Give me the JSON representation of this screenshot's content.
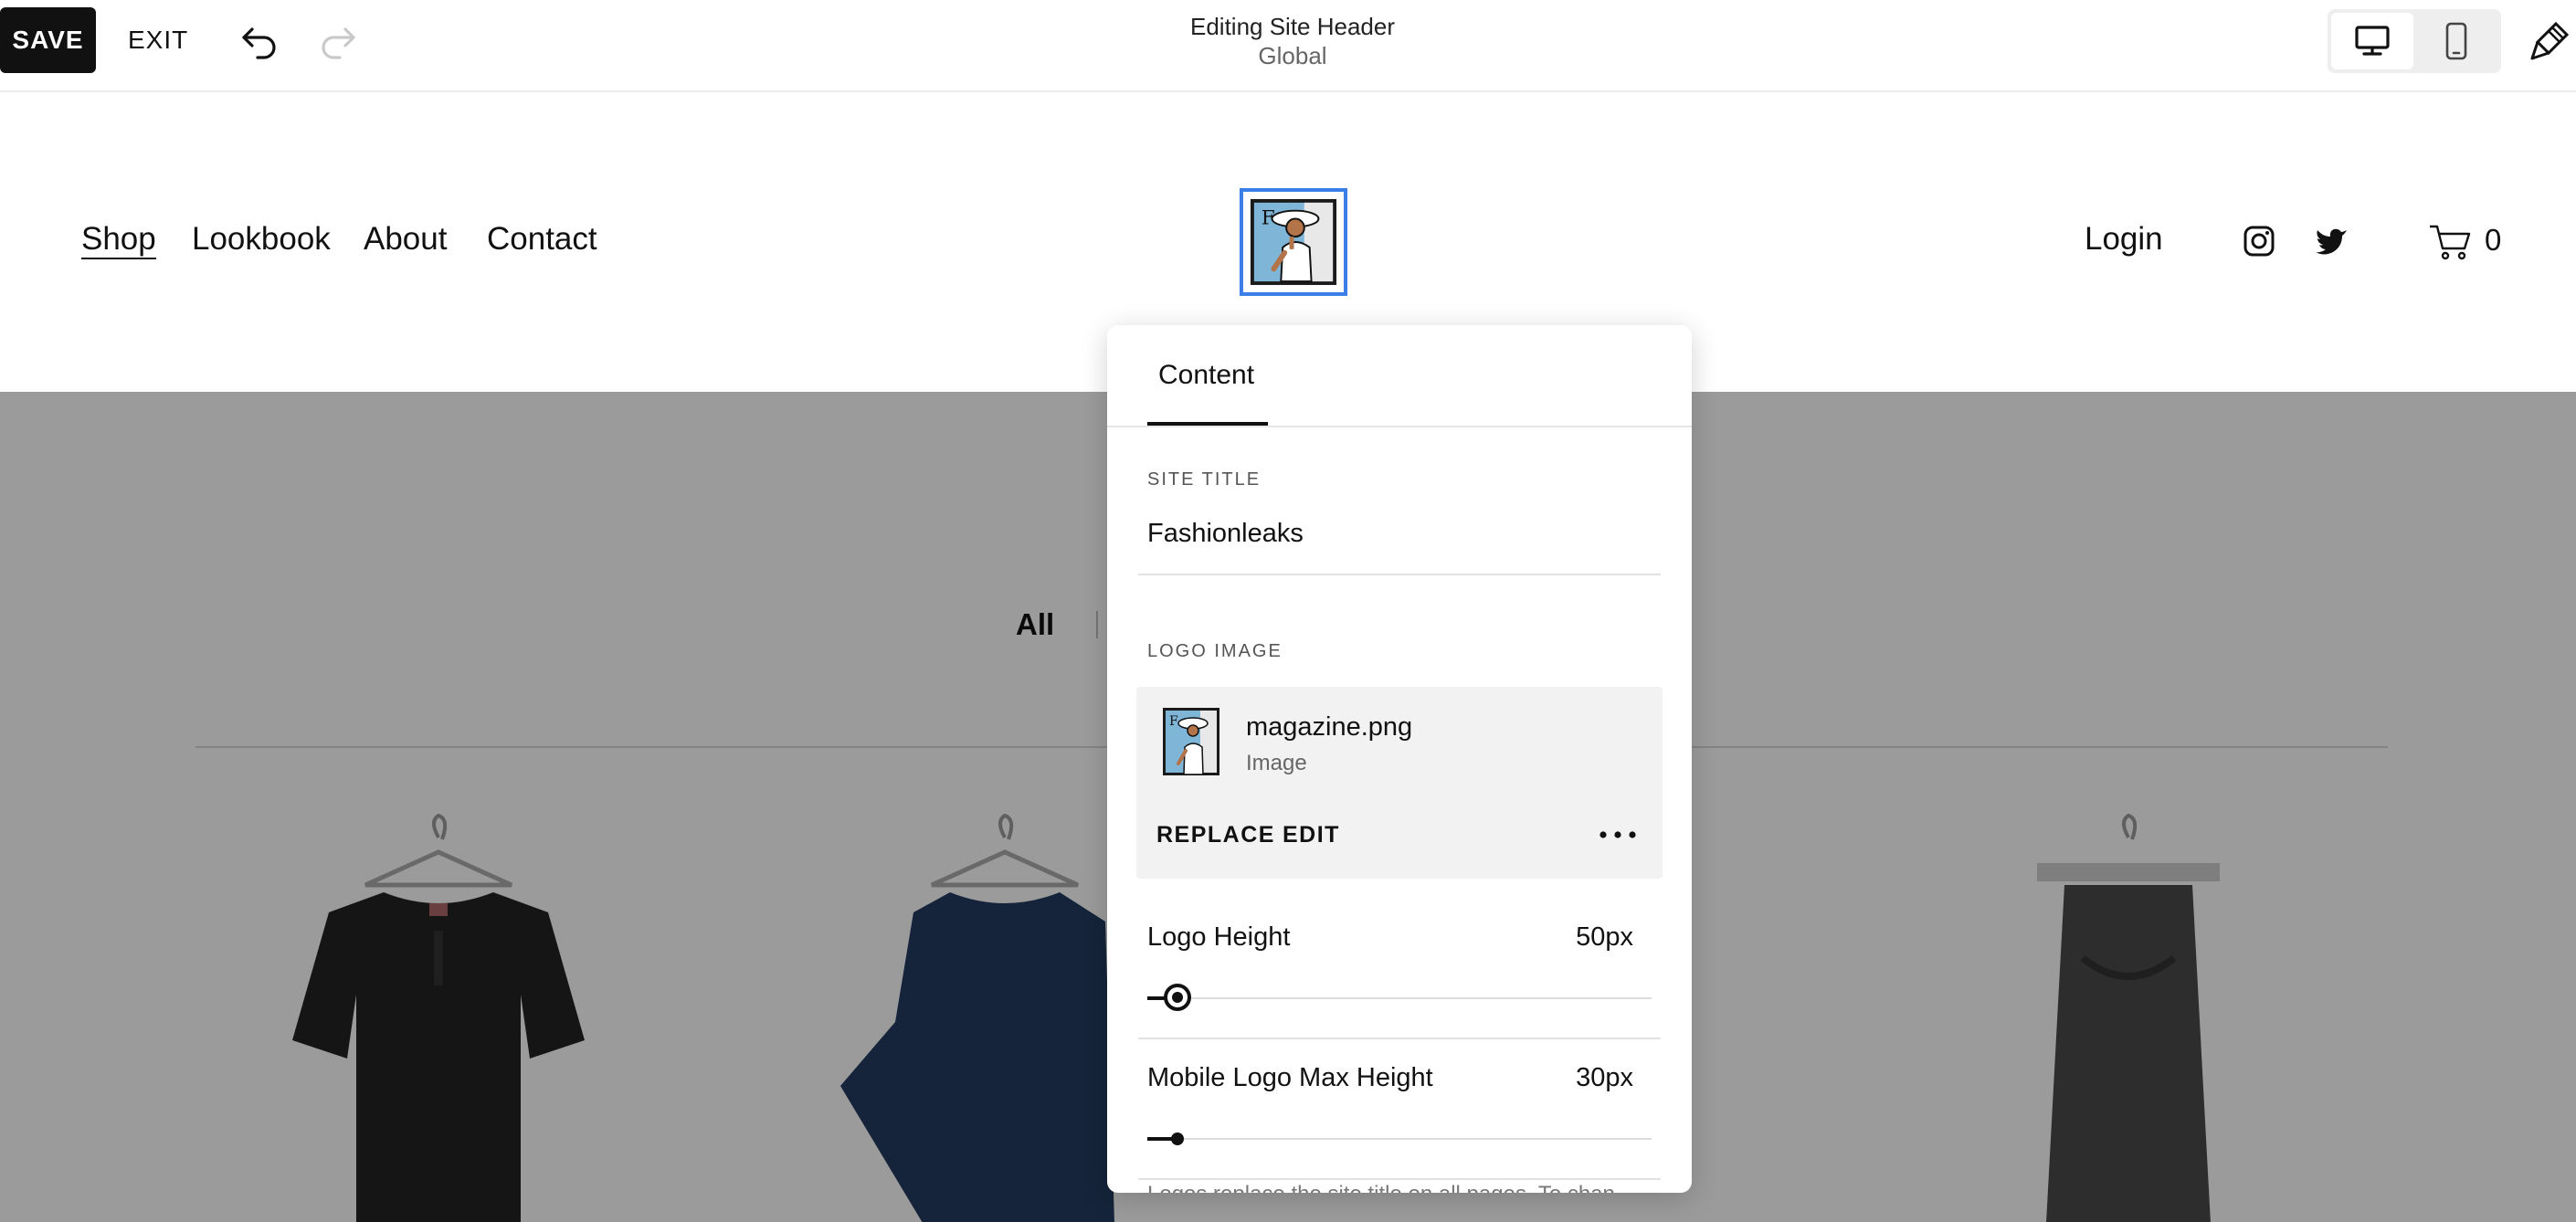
{
  "toolbar": {
    "save_label": "SAVE",
    "exit_label": "EXIT",
    "undo_icon": "undo-icon",
    "redo_icon": "redo-icon",
    "editing_title": "Editing Site Header",
    "editing_subtitle": "Global",
    "device_desktop_icon": "desktop-icon",
    "device_mobile_icon": "mobile-icon",
    "design_icon": "paintbrush-icon"
  },
  "site_header": {
    "nav": [
      "Shop",
      "Lookbook",
      "About",
      "Contact"
    ],
    "active_nav": "Shop",
    "login_label": "Login",
    "social_icons": [
      "instagram-icon",
      "twitter-icon"
    ],
    "cart_count": "0",
    "selection_color": "#3b7ee8"
  },
  "page": {
    "filter_all": "All"
  },
  "panel": {
    "tab_label": "Content",
    "site_title_label": "SITE TITLE",
    "site_title_value": "Fashionleaks",
    "logo_image_label": "LOGO IMAGE",
    "logo_file_name": "magazine.png",
    "logo_file_type": "Image",
    "replace_label": "REPLACE",
    "edit_label": "EDIT",
    "logo_height": {
      "label": "Logo Height",
      "value": "50px",
      "fraction": 0.06
    },
    "mobile_logo_max_height": {
      "label": "Mobile Logo Max Height",
      "value": "30px",
      "fraction": 0.06
    },
    "help_text": "Logos replace the site title on all pages. To chan"
  }
}
